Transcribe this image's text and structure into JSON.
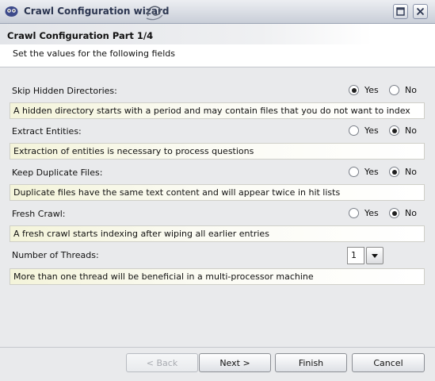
{
  "window": {
    "title": "Crawl Configuration wizard"
  },
  "header": {
    "title": "Crawl Configuration Part 1/4",
    "subtitle": "Set the values for the following fields"
  },
  "fields": [
    {
      "label": "Skip Hidden Directories:",
      "options": [
        "Yes",
        "No"
      ],
      "selected": "Yes",
      "hint": "A hidden directory starts with a period and may contain files that you do not want to index"
    },
    {
      "label": "Extract Entities:",
      "options": [
        "Yes",
        "No"
      ],
      "selected": "No",
      "hint": "Extraction of entities is necessary to process questions"
    },
    {
      "label": "Keep Duplicate Files:",
      "options": [
        "Yes",
        "No"
      ],
      "selected": "No",
      "hint": "Duplicate files have the same text content and will appear twice in hit lists"
    },
    {
      "label": "Fresh Crawl:",
      "options": [
        "Yes",
        "No"
      ],
      "selected": "No",
      "hint": "A fresh crawl starts indexing after wiping all earlier entries"
    }
  ],
  "threads": {
    "label": "Number of Threads:",
    "value": "1",
    "hint": "More than one thread will be beneficial in a multi-processor machine"
  },
  "buttons": {
    "back": "< Back",
    "next": "Next >",
    "finish": "Finish",
    "cancel": "Cancel"
  }
}
